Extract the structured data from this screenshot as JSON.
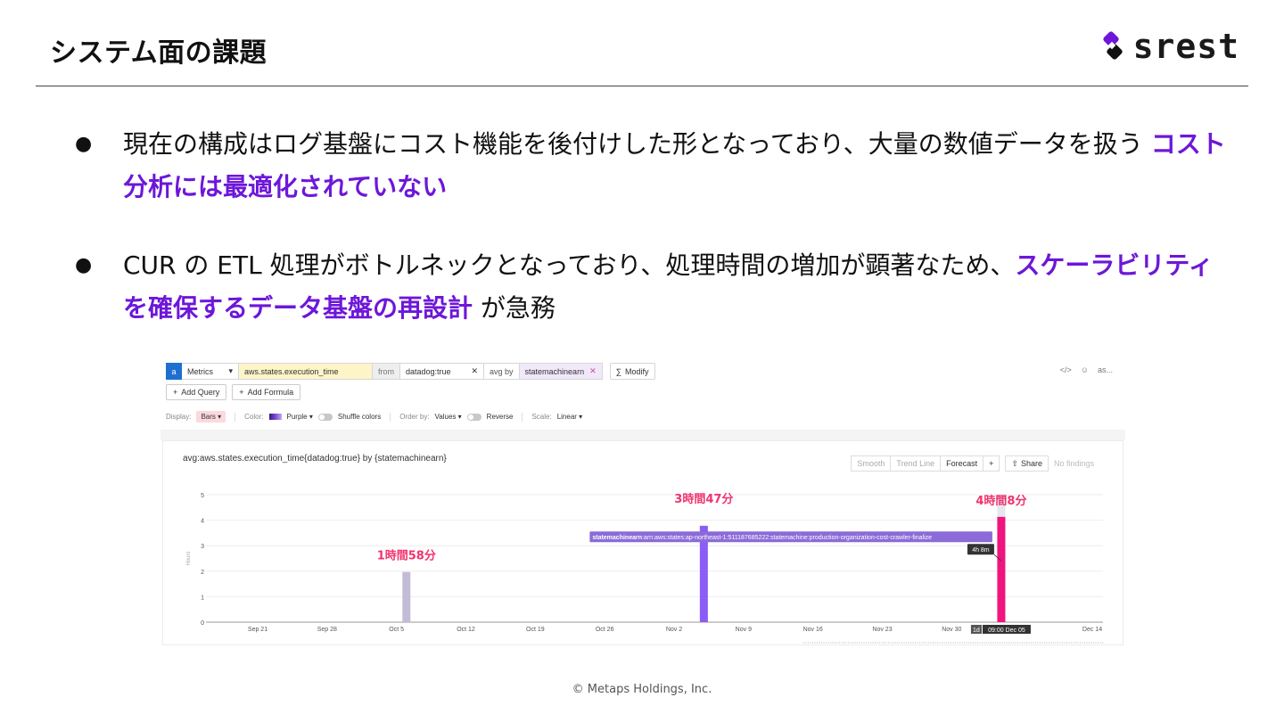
{
  "slide": {
    "title": "システム面の課題",
    "logo_text": "srest",
    "footer": "© Metaps Holdings,  Inc."
  },
  "bullets": [
    {
      "marker": "●",
      "pre": "現在の構成はログ基盤にコスト機能を後付けした形となっており、大量の数値データを扱う ",
      "highlight": "コスト分析には最適化されていない",
      "post": ""
    },
    {
      "marker": "●",
      "pre": "CUR の ETL 処理がボトルネックとなっており、処理時間の増加が顕著なため、",
      "highlight": "スケーラビリティを確保するデータ基盤の再設計",
      "post": " が急務"
    }
  ],
  "query": {
    "letter": "a",
    "source": "Metrics",
    "metric": "aws.states.execution_time",
    "from_label": "from",
    "tag": "datadog:true",
    "avg_by_label": "avg by",
    "group": "statemachinearn",
    "modify": "Modify",
    "right_tools": [
      "</>",
      "☺",
      "as..."
    ]
  },
  "buttons": {
    "add_query": "Add Query",
    "add_formula": "Add Formula"
  },
  "display_row": {
    "display_label": "Display:",
    "display_value": "Bars",
    "color_label": "Color:",
    "color_value": "Purple",
    "shuffle_label": "Shuffle colors",
    "order_label": "Order by:",
    "order_value": "Values",
    "reverse_label": "Reverse",
    "scale_label": "Scale:",
    "scale_value": "Linear"
  },
  "chart_toolbar": {
    "smooth": "Smooth",
    "trend": "Trend Line",
    "forecast": "Forecast",
    "plus": "+",
    "share": "Share",
    "no_findings": "No findings"
  },
  "chart_data": {
    "type": "bar",
    "title": "avg:aws.states.execution_time{datadog:true} by {statemachinearn}",
    "ylabel": "Hours",
    "ylim": [
      0,
      5
    ],
    "yticks": [
      0,
      1,
      2,
      3,
      4,
      5
    ],
    "x_ticks": [
      "Sep 21",
      "Sep 28",
      "Oct 5",
      "Oct 12",
      "Oct 19",
      "Oct 26",
      "Nov 2",
      "Nov 9",
      "Nov 16",
      "Nov 23",
      "Nov 30",
      "Dec 14"
    ],
    "grid": true,
    "bars": [
      {
        "x_day": 15,
        "value": 1.97,
        "color": "#c3bcd6",
        "annotation": "1時間58分"
      },
      {
        "x_day": 45,
        "value": 3.78,
        "color": "#8b5cf6",
        "annotation": "3時間47分"
      },
      {
        "x_day": 75,
        "value": 4.13,
        "color": "#f0147f",
        "annotation": "4時間8分"
      }
    ],
    "tooltip": {
      "key": "statemachinearn",
      "value": ":arn:aws:states:ap-northeast-1:511187685222:statemachine:production-organization-cost-crawler-finalize"
    },
    "value_label": "4h 8m",
    "crosshair_label": {
      "range": "1d",
      "time": "09:00 Dec 05"
    },
    "annotation_color": "#f0336e"
  }
}
